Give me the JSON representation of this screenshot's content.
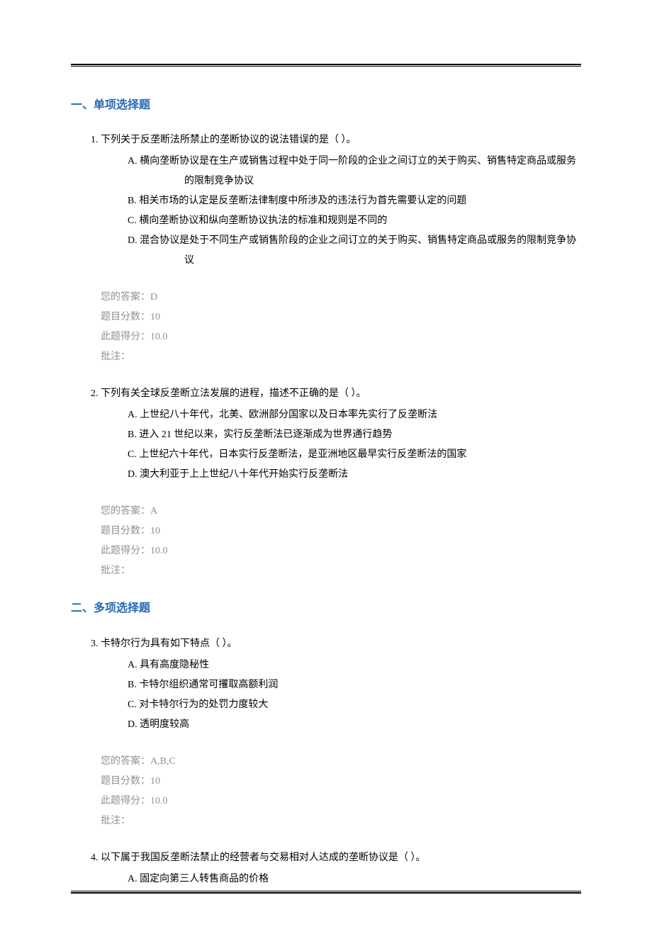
{
  "sections": {
    "s1": {
      "num": "一、",
      "title": "单项选择题"
    },
    "s2": {
      "num": "二、",
      "title": "多项选择题"
    }
  },
  "questions": {
    "q1": {
      "number": "1.",
      "text": "下列关于反垄断法所禁止的垄断协议的说法错误的是（ ）。",
      "options": {
        "a": "A. 横向垄断协议是在生产或销售过程中处于同一阶段的企业之间订立的关于购买、销售特定商品或服务的限制竞争协议",
        "b": "B. 相关市场的认定是反垄断法律制度中所涉及的违法行为首先需要认定的问题",
        "c": "C. 横向垄断协议和纵向垄断协议执法的标准和规则是不同的",
        "d": "D. 混合协议是处于不同生产或销售阶段的企业之间订立的关于购买、销售特定商品或服务的限制竞争协议"
      },
      "answer": {
        "your_answer": "您的答案：D",
        "score_total": "题目分数：10",
        "score_got": "此题得分：10.0",
        "remark": "批注："
      }
    },
    "q2": {
      "number": "2.",
      "text": "下列有关全球反垄断立法发展的进程，描述不正确的是（ ）。",
      "options": {
        "a": "A. 上世纪八十年代，北美、欧洲部分国家以及日本率先实行了反垄断法",
        "b": "B. 进入 21 世纪以来，实行反垄断法已逐渐成为世界通行趋势",
        "c": "C. 上世纪六十年代，日本实行反垄断法，是亚洲地区最早实行反垄断法的国家",
        "d": "D. 澳大利亚于上上世纪八十年代开始实行反垄断法"
      },
      "answer": {
        "your_answer": "您的答案：A",
        "score_total": "题目分数：10",
        "score_got": "此题得分：10.0",
        "remark": "批注："
      }
    },
    "q3": {
      "number": "3.",
      "text": "卡特尔行为具有如下特点（ ）。",
      "options": {
        "a": "A. 具有高度隐秘性",
        "b": "B. 卡特尔组织通常可攫取高额利润",
        "c": "C. 对卡特尔行为的处罚力度较大",
        "d": "D. 透明度较高"
      },
      "answer": {
        "your_answer": "您的答案：A,B,C",
        "score_total": "题目分数：10",
        "score_got": "此题得分：10.0",
        "remark": "批注："
      }
    },
    "q4": {
      "number": "4.",
      "text": "以下属于我国反垄断法禁止的经营者与交易相对人达成的垄断协议是（ ）。",
      "options": {
        "a": "A. 固定向第三人转售商品的价格"
      }
    }
  }
}
